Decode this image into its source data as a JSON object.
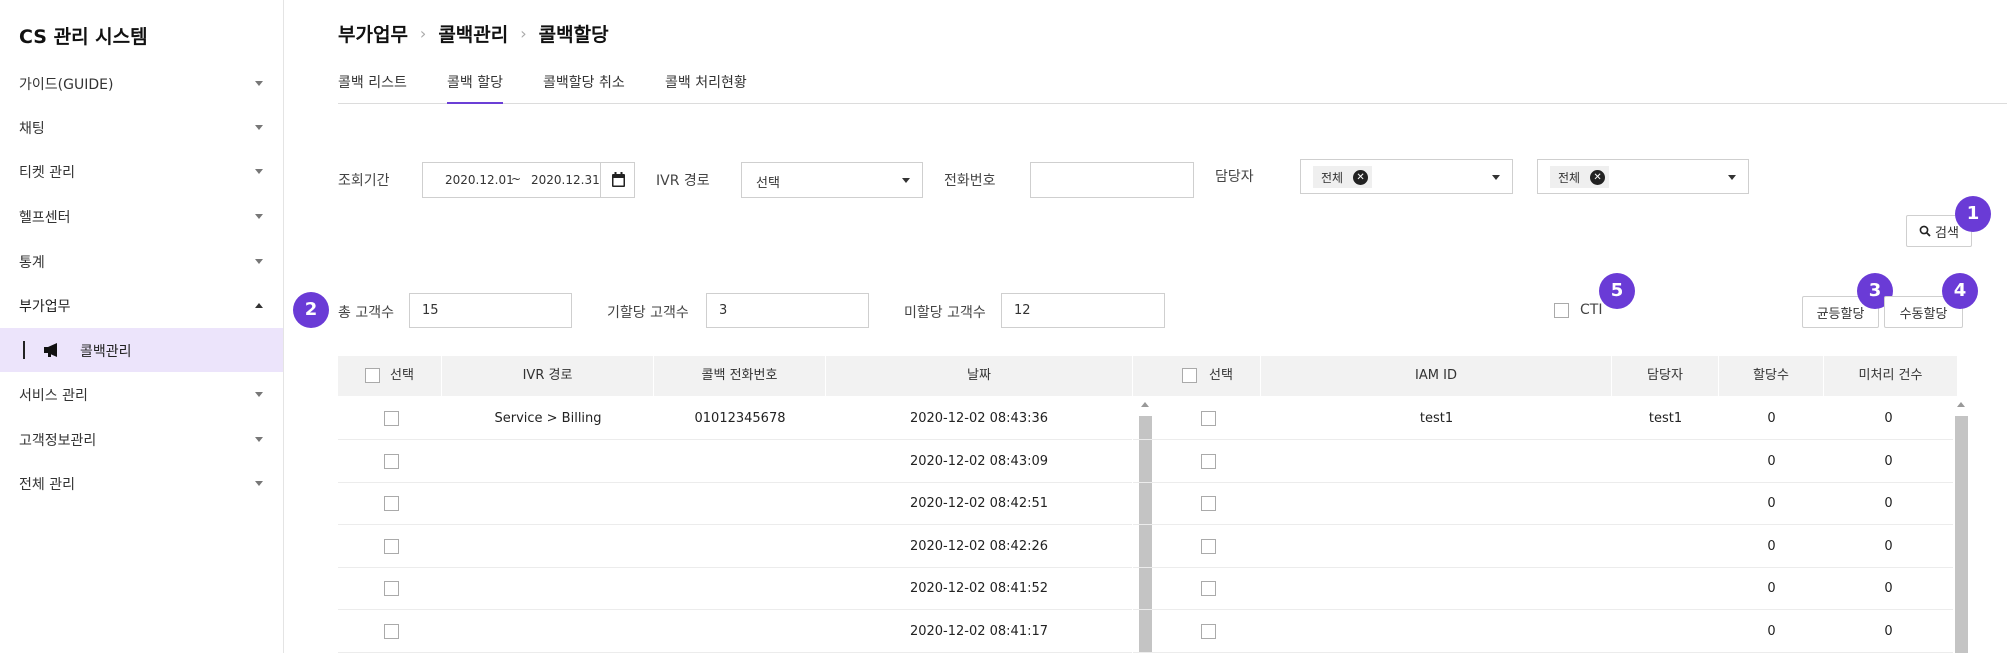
{
  "sidebar": {
    "title": "CS 관리 시스템",
    "items": [
      {
        "label": "가이드(GUIDE)"
      },
      {
        "label": "채팅"
      },
      {
        "label": "티켓 관리"
      },
      {
        "label": "헬프센터"
      },
      {
        "label": "통계"
      },
      {
        "label": "부가업무"
      },
      {
        "label": "서비스 관리"
      },
      {
        "label": "고객정보관리"
      },
      {
        "label": "전체 관리"
      }
    ],
    "sub_item": {
      "label": "콜백관리",
      "icon": "megaphone-icon"
    }
  },
  "breadcrumb": [
    "부가업무",
    "콜백관리",
    "콜백할당"
  ],
  "tabs": [
    {
      "label": "콜백 리스트"
    },
    {
      "label": "콜백 할당",
      "active": true
    },
    {
      "label": "콜백할당 취소"
    },
    {
      "label": "콜백 처리현황"
    }
  ],
  "filters": {
    "period_label": "조회기간",
    "date_from": "2020.12.01",
    "date_sep": "~",
    "date_to": "2020.12.31",
    "ivr_label": "IVR 경로",
    "ivr_value": "선택",
    "phone_label": "전화번호",
    "phone_value": "",
    "agent_label": "담당자",
    "agent_select1": "전체",
    "agent_select2": "전체",
    "search_label": "검색"
  },
  "stats": {
    "total_label": "총 고객수",
    "total_value": "15",
    "assigned_label": "기할당 고객수",
    "assigned_value": "3",
    "unassigned_label": "미할당 고객수",
    "unassigned_value": "12",
    "cti_label": "CTI",
    "equal_assign_label": "균등할당",
    "manual_assign_label": "수동할당"
  },
  "badges": [
    "1",
    "2",
    "3",
    "4",
    "5"
  ],
  "left_table": {
    "headers": [
      "선택",
      "IVR 경로",
      "콜백 전화번호",
      "날짜"
    ],
    "rows": [
      {
        "ivr": "Service > Billing",
        "phone": "01012345678",
        "date": "2020-12-02 08:43:36"
      },
      {
        "ivr": "",
        "phone": "",
        "date": "2020-12-02 08:43:09"
      },
      {
        "ivr": "",
        "phone": "",
        "date": "2020-12-02 08:42:51"
      },
      {
        "ivr": "",
        "phone": "",
        "date": "2020-12-02 08:42:26"
      },
      {
        "ivr": "",
        "phone": "",
        "date": "2020-12-02 08:41:52"
      },
      {
        "ivr": "",
        "phone": "",
        "date": "2020-12-02 08:41:17"
      }
    ]
  },
  "right_table": {
    "headers": [
      "선택",
      "IAM ID",
      "담당자",
      "할당수",
      "미처리 건수"
    ],
    "rows": [
      {
        "iam": "test1",
        "agent": "test1",
        "assigned": "0",
        "pending": "0"
      },
      {
        "iam": "",
        "agent": "",
        "assigned": "0",
        "pending": "0"
      },
      {
        "iam": "",
        "agent": "",
        "assigned": "0",
        "pending": "0"
      },
      {
        "iam": "",
        "agent": "",
        "assigned": "0",
        "pending": "0"
      },
      {
        "iam": "",
        "agent": "",
        "assigned": "0",
        "pending": "0"
      },
      {
        "iam": "",
        "agent": "",
        "assigned": "0",
        "pending": "0"
      }
    ]
  },
  "colors": {
    "accent": "#6a3bd6",
    "sub_active_bg": "#ece4fb"
  }
}
